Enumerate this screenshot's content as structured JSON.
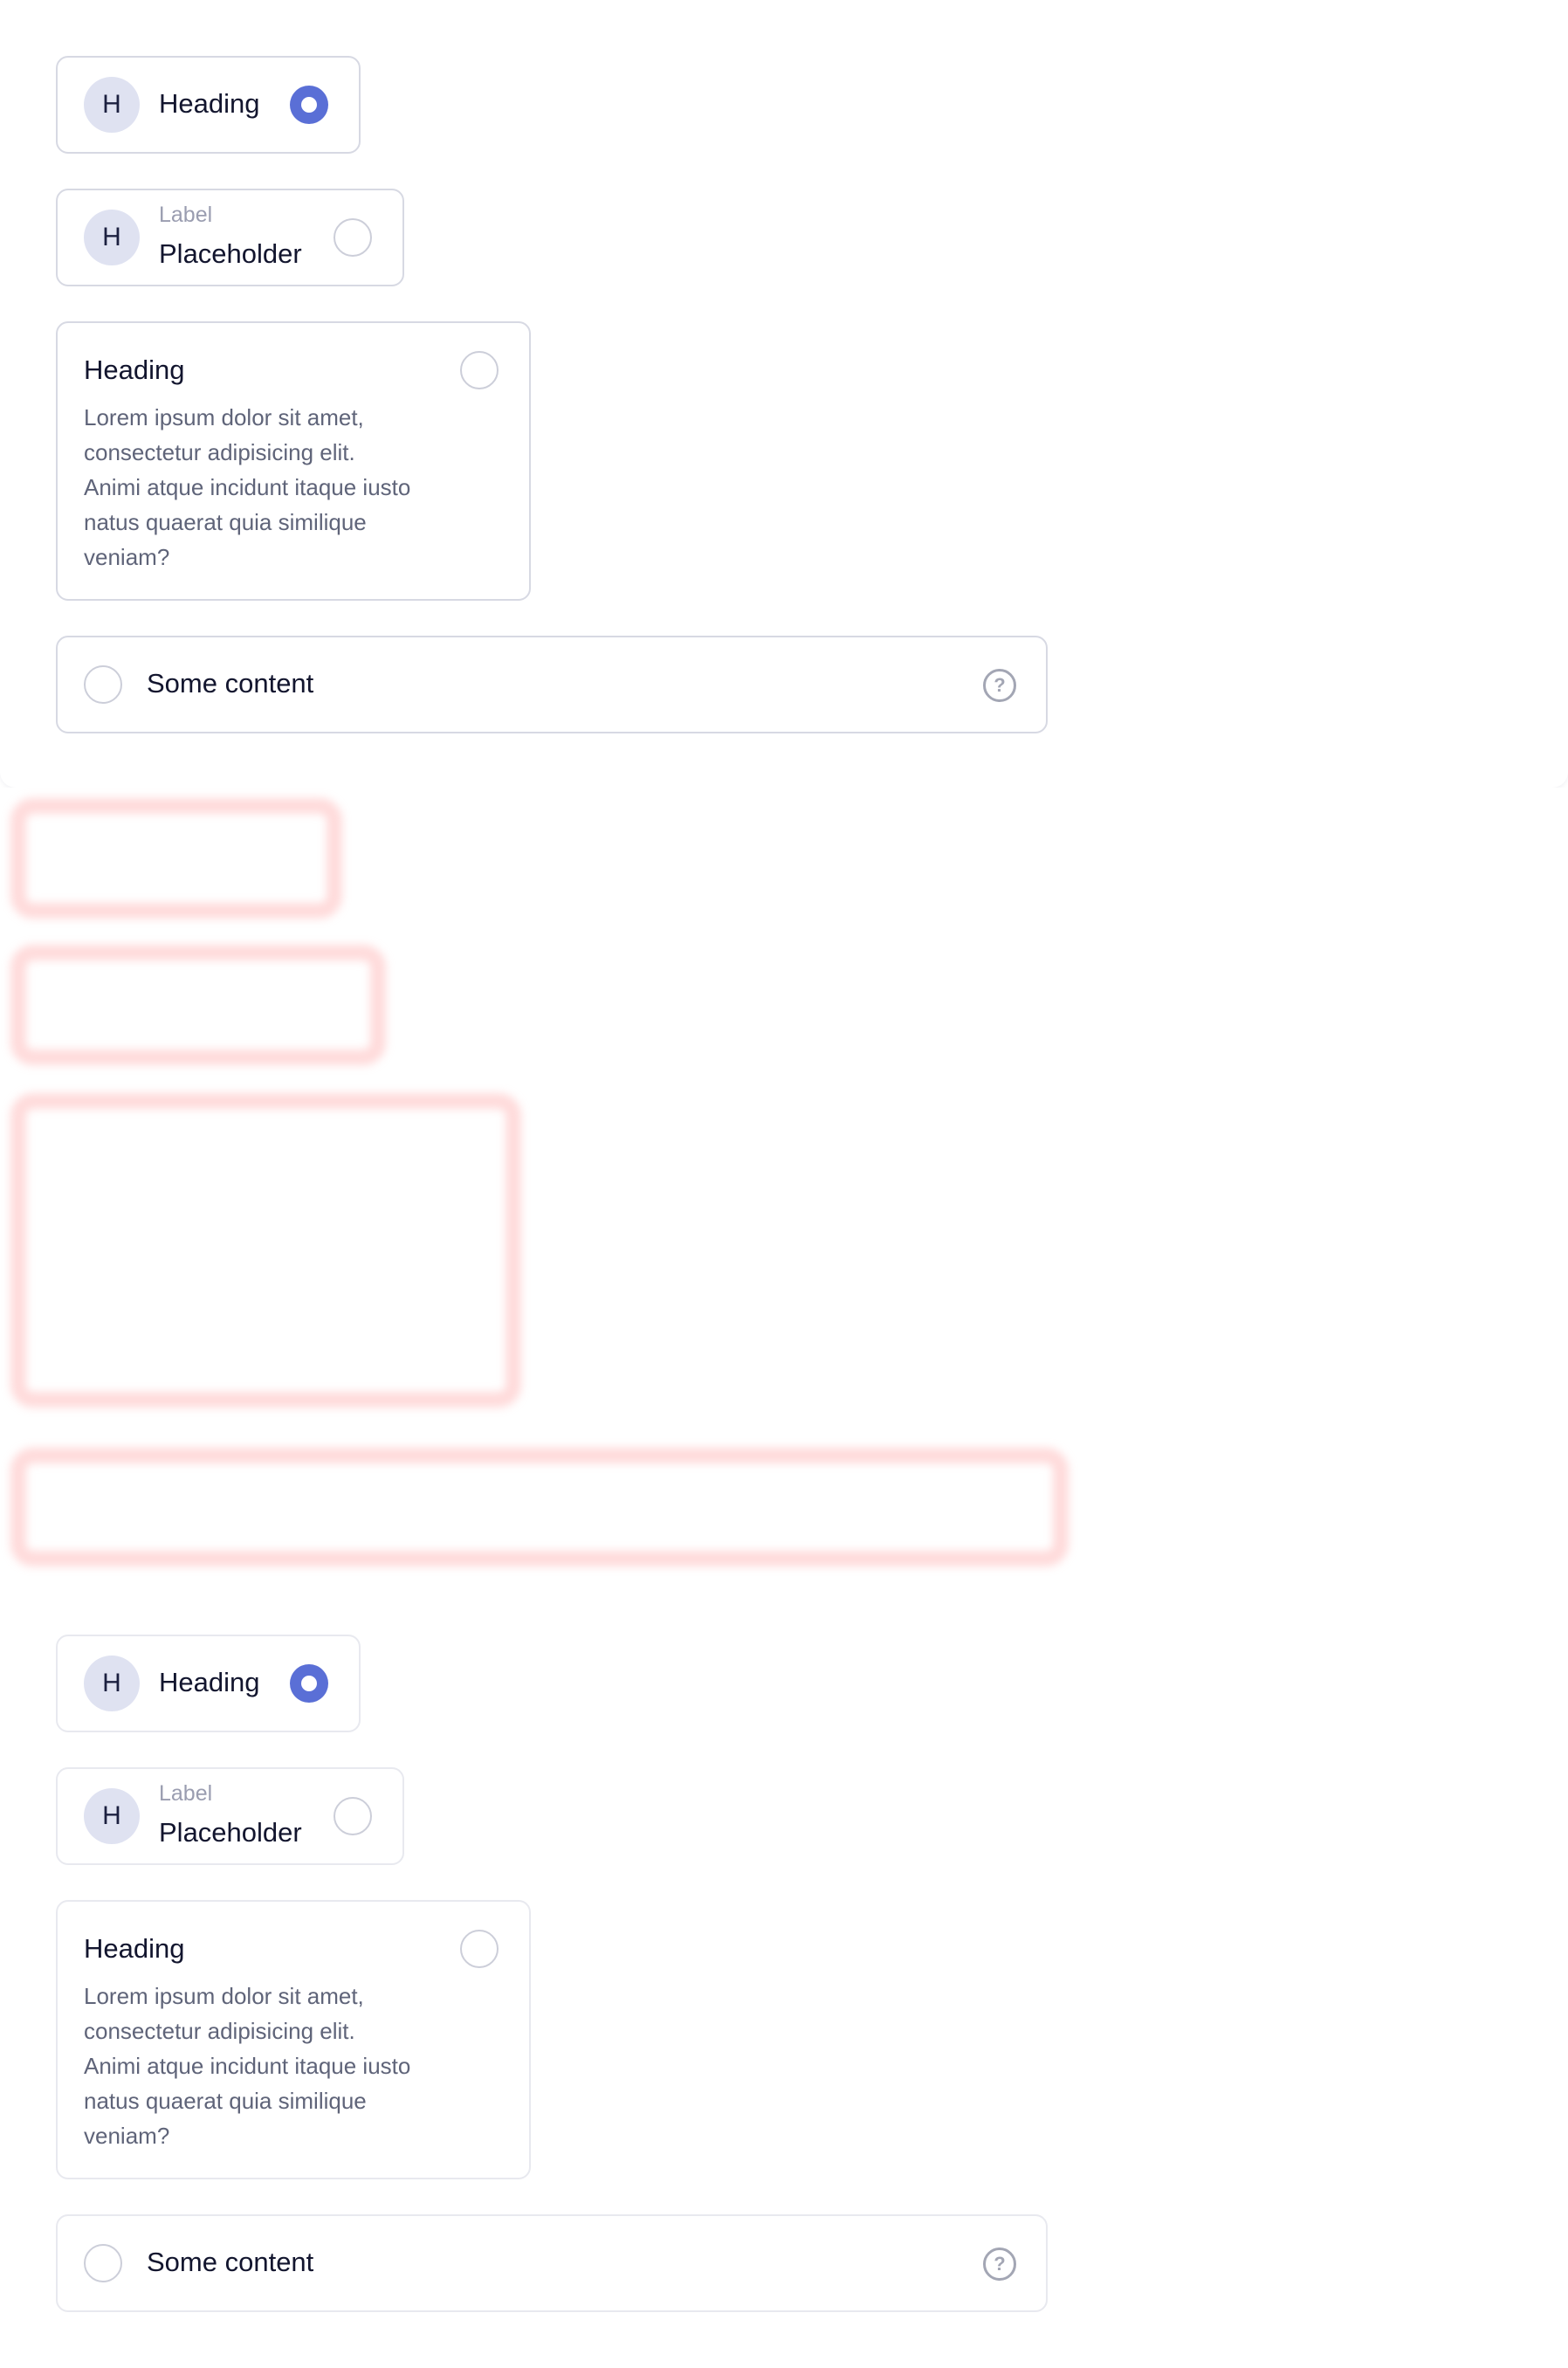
{
  "variants": {
    "top": {
      "heading_card": {
        "avatar_letter": "H",
        "title": "Heading",
        "selected": true
      },
      "label_card": {
        "avatar_letter": "H",
        "label": "Label",
        "placeholder": "Placeholder",
        "selected": false
      },
      "text_card": {
        "title": "Heading",
        "body": "Lorem ipsum dolor sit amet, consectetur adipisicing elit. Animi atque incidunt itaque iusto natus quaerat quia similique veniam?",
        "selected": false
      },
      "content_row": {
        "text": "Some content",
        "help_glyph": "?",
        "selected": false
      }
    },
    "bottom": {
      "heading_card": {
        "avatar_letter": "H",
        "title": "Heading",
        "selected": true
      },
      "label_card": {
        "avatar_letter": "H",
        "label": "Label",
        "placeholder": "Placeholder",
        "selected": false
      },
      "text_card": {
        "title": "Heading",
        "body": "Lorem ipsum dolor sit amet, consectetur adipisicing elit. Animi atque incidunt itaque iusto natus quaerat quia similique veniam?",
        "selected": false
      },
      "content_row": {
        "text": "Some content",
        "help_glyph": "?",
        "selected": false
      }
    }
  },
  "colors": {
    "accent": "#5a6fd6",
    "avatar_bg": "#dfe2f1",
    "text_primary": "#12152e",
    "text_secondary": "#5f6479",
    "text_muted": "#9a9db0",
    "focus_ring": "#ffa0a0"
  },
  "icons": {
    "help": "help-circle-icon"
  }
}
